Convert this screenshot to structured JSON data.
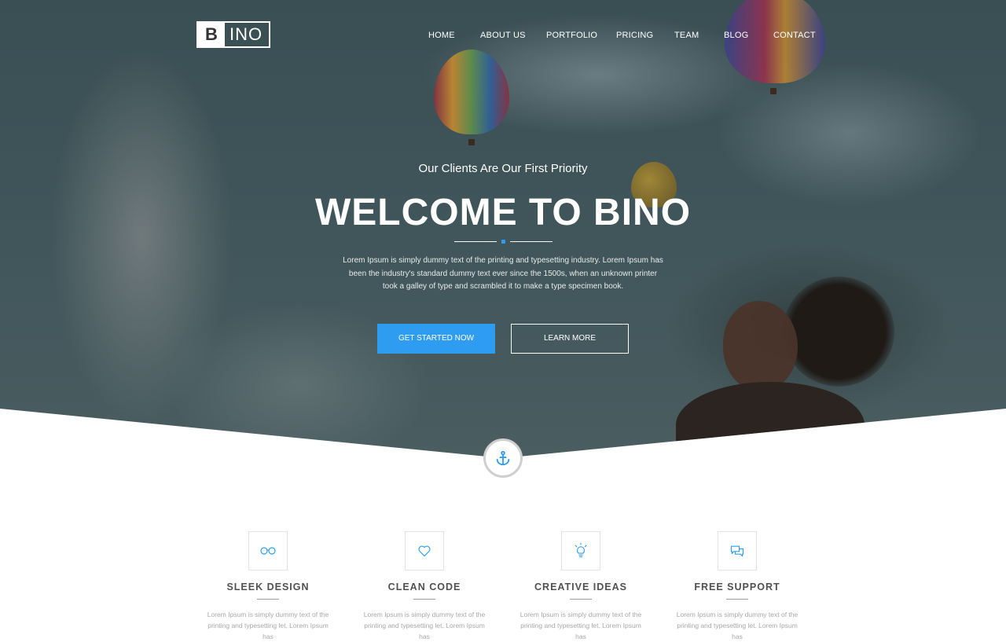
{
  "brand": {
    "logo_letter": "B",
    "logo_rest": "INO"
  },
  "nav": {
    "items": [
      {
        "label": "HOME"
      },
      {
        "label": "ABOUT US"
      },
      {
        "label": "PORTFOLIO"
      },
      {
        "label": "PRICING"
      },
      {
        "label": "TEAM"
      },
      {
        "label": "BLOG"
      },
      {
        "label": "CONTACT"
      }
    ]
  },
  "hero": {
    "tagline": "Our Clients Are Our First Priority",
    "headline": "WELCOME TO BINO",
    "intro": "Lorem Ipsum is simply dummy text of the printing and typesetting industry. Lorem Ipsum has been the industry's standard dummy text ever since the 1500s, when an unknown printer took a galley of type and scrambled it to make a type specimen book.",
    "primary_button": "GET STARTED NOW",
    "secondary_button": "LEARN MORE"
  },
  "scroll_anchor": {
    "icon": "anchor-icon"
  },
  "features": [
    {
      "icon": "glasses-icon",
      "title": "SLEEK DESIGN",
      "desc": "Lorem Ipsum is simply dummy text of the printing and typesetting let. Lorem Ipsum has"
    },
    {
      "icon": "heart-icon",
      "title": "CLEAN CODE",
      "desc": "Lorem Ipsum is simply dummy text of the printing and typesetting let. Lorem Ipsum has"
    },
    {
      "icon": "lightbulb-icon",
      "title": "CREATIVE IDEAS",
      "desc": "Lorem Ipsum is simply dummy text of the printing and typesetting let. Lorem Ipsum has"
    },
    {
      "icon": "chat-icon",
      "title": "FREE SUPPORT",
      "desc": "Lorem Ipsum is simply dummy text of the printing and typesetting let. Lorem Ipsum has"
    }
  ],
  "colors": {
    "accent": "#2e9cf0",
    "hero_overlay": "#3f555a",
    "heading_text": "#505050",
    "body_text": "#a8a8a8"
  }
}
